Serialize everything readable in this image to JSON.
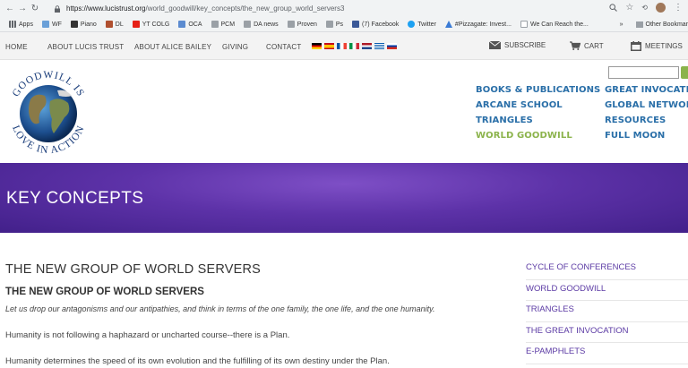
{
  "browser": {
    "url_host": "https://www.lucistrust.org",
    "url_path": "/world_goodwill/key_concepts/the_new_group_world_servers3",
    "bookmarks": [
      {
        "label": "Apps",
        "color": "#4285f4"
      },
      {
        "label": "WF",
        "color": "#6aa0d8"
      },
      {
        "label": "Piano",
        "color": "#333333"
      },
      {
        "label": "DL",
        "color": "#b05030"
      },
      {
        "label": "YT COLG",
        "color": "#e62117"
      },
      {
        "label": "OCA",
        "color": "#5b8bd0"
      },
      {
        "label": "PCM",
        "color": "#9aa0a6"
      },
      {
        "label": "DA news",
        "color": "#9aa0a6"
      },
      {
        "label": "Proven",
        "color": "#9aa0a6"
      },
      {
        "label": "Ps",
        "color": "#9aa0a6"
      },
      {
        "label": "(7) Facebook",
        "color": "#3b5998"
      },
      {
        "label": "Twitter",
        "color": "#1da1f2"
      },
      {
        "label": "#Pizzagate: Invest...",
        "color": "#3a7bd5"
      },
      {
        "label": "We Can Reach the...",
        "color": "#9aa0a6"
      }
    ],
    "overflow_label": "»",
    "other_bookmarks": "Other Bookmar"
  },
  "topnav": {
    "home": "HOME",
    "about_lucis": "ABOUT LUCIS TRUST",
    "about_alice": "ABOUT ALICE BAILEY",
    "giving": "GIVING",
    "contact": "CONTACT",
    "subscribe": "SUBSCRIBE",
    "cart": "CART",
    "meetings": "MEETINGS"
  },
  "logo": {
    "text_top": "GOODWILL IS",
    "text_bottom": "LOVE IN ACTION"
  },
  "menu": {
    "col1": [
      "BOOKS & PUBLICATIONS",
      "ARCANE SCHOOL",
      "TRIANGLES",
      "WORLD GOODWILL"
    ],
    "col2": [
      "GREAT INVOCATIO",
      "GLOBAL NETWORK",
      "RESOURCES",
      "FULL MOON"
    ]
  },
  "banner": {
    "title": "KEY CONCEPTS"
  },
  "content": {
    "title": "THE NEW GROUP OF WORLD SERVERS",
    "subtitle": "THE NEW GROUP OF WORLD SERVERS",
    "quote": "Let us drop our antagonisms and our antipathies, and think in terms of the one family, the one life, and the one humanity.",
    "para1": "Humanity is not following a haphazard or uncharted course--there is a Plan.",
    "para2": "Humanity determines the speed of its own evolution and the fulfilling of its own destiny under the Plan."
  },
  "sidenav": [
    "CYCLE OF CONFERENCES",
    "WORLD GOODWILL",
    "TRIANGLES",
    "THE GREAT INVOCATION",
    "E-PAMPHLETS"
  ],
  "colors": {
    "banner_purple": "#5d32a8",
    "menu_blue": "#2a6fa8",
    "menu_active_green": "#8bb34b",
    "sidenav_purple": "#5b3aa4"
  }
}
